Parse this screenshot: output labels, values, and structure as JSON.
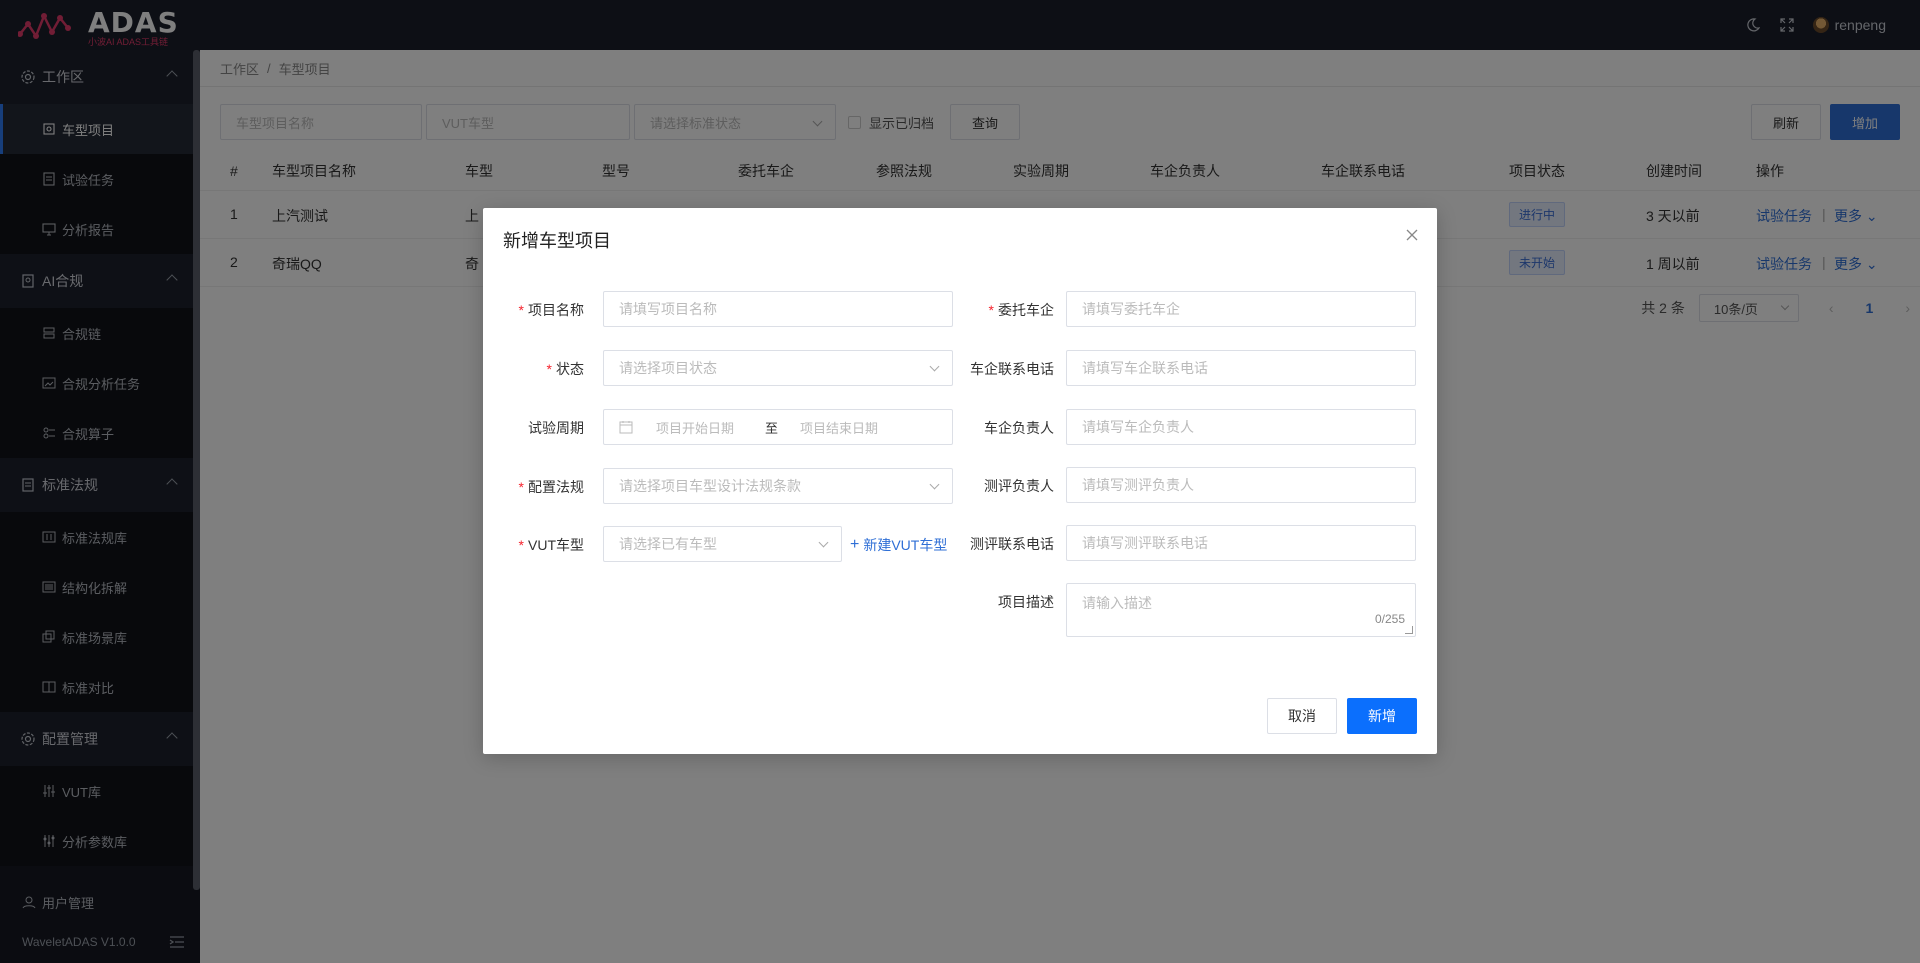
{
  "app": {
    "logo_text": "ADAS",
    "logo_subtitle": "小波AI ADAS工具链",
    "username": "renpeng",
    "version": "WaveletADAS  V1.0.0"
  },
  "sidebar": {
    "groups": [
      {
        "label": "工作区",
        "items": [
          "车型项目",
          "试验任务",
          "分析报告"
        ]
      },
      {
        "label": "AI合规",
        "items": [
          "合规链",
          "合规分析任务",
          "合规算子"
        ]
      },
      {
        "label": "标准法规",
        "items": [
          "标准法规库",
          "结构化拆解",
          "标准场景库",
          "标准对比"
        ]
      },
      {
        "label": "配置管理",
        "items": [
          "VUT库",
          "分析参数库"
        ]
      }
    ],
    "user_mgmt": "用户管理"
  },
  "breadcrumb": {
    "root": "工作区",
    "sep": "/",
    "current": "车型项目"
  },
  "filters": {
    "name_placeholder": "车型项目名称",
    "vut_placeholder": "VUT车型",
    "status_placeholder": "请选择标准状态",
    "show_archived": "显示已归档",
    "query": "查询",
    "refresh": "刷新",
    "add": "增加"
  },
  "table": {
    "headers": [
      "#",
      "车型项目名称",
      "车型",
      "型号",
      "委托车企",
      "参照法规",
      "实验周期",
      "车企负责人",
      "车企联系电话",
      "项目状态",
      "创建时间",
      "操作"
    ],
    "rows": [
      {
        "idx": "1",
        "name": "上汽测试",
        "car": "上",
        "status": "进行中",
        "created": "3 天以前",
        "task": "试验任务",
        "more": "更多"
      },
      {
        "idx": "2",
        "name": "奇瑞QQ",
        "car": "奇",
        "status": "未开始",
        "created": "1 周以前",
        "task": "试验任务",
        "more": "更多"
      }
    ],
    "op_sep": "|"
  },
  "pager": {
    "total": "共 2 条",
    "page_size": "10条/页",
    "page": "1"
  },
  "modal": {
    "title": "新增车型项目",
    "fields": {
      "name": {
        "label": "项目名称",
        "placeholder": "请填写项目名称"
      },
      "status": {
        "label": "状态",
        "placeholder": "请选择项目状态"
      },
      "period": {
        "label": "试验周期",
        "start": "项目开始日期",
        "sep": "至",
        "end": "项目结束日期"
      },
      "regulation": {
        "label": "配置法规",
        "placeholder": "请选择项目车型设计法规条款"
      },
      "vut": {
        "label": "VUT车型",
        "placeholder": "请选择已有车型",
        "new_link": "新建VUT车型"
      },
      "client": {
        "label": "委托车企",
        "placeholder": "请填写委托车企"
      },
      "client_phone": {
        "label": "车企联系电话",
        "placeholder": "请填写车企联系电话"
      },
      "client_owner": {
        "label": "车企负责人",
        "placeholder": "请填写车企负责人"
      },
      "eval_owner": {
        "label": "测评负责人",
        "placeholder": "请填写测评负责人"
      },
      "eval_phone": {
        "label": "测评联系电话",
        "placeholder": "请填写测评联系电话"
      },
      "desc": {
        "label": "项目描述",
        "placeholder": "请输入描述",
        "counter": "0/255"
      }
    },
    "cancel": "取消",
    "submit": "新增"
  },
  "required_mark": "*"
}
